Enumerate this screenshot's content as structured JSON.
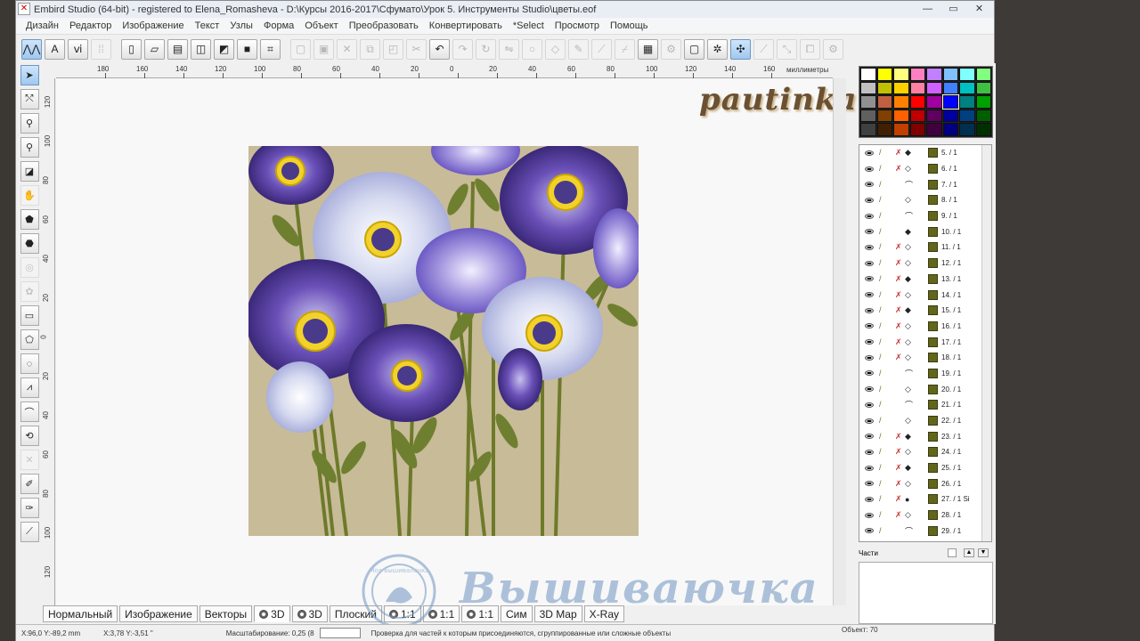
{
  "window": {
    "title": "Embird Studio (64-bit) - registered to Elena_Romasheva - D:\\Курсы 2016-2017\\Сфумато\\Урок 5. Инструменты Studio\\цветы.eof"
  },
  "menu": [
    "Дизайн",
    "Редактор",
    "Изображение",
    "Текст",
    "Узлы",
    "Форма",
    "Объект",
    "Преобразовать",
    "Конвертировать",
    "*Select",
    "Просмотр",
    "Помощь"
  ],
  "ruler": {
    "unit": "миллиметры",
    "top": [
      "180",
      "160",
      "140",
      "120",
      "100",
      "80",
      "60",
      "40",
      "20",
      "0",
      "20",
      "40",
      "60",
      "80",
      "100",
      "120",
      "140",
      "160"
    ],
    "left": [
      "120",
      "100",
      "80",
      "60",
      "40",
      "20",
      "0",
      "20",
      "40",
      "60",
      "80",
      "100",
      "120"
    ]
  },
  "logo": "pautinka",
  "view_tabs": [
    "Нормальный",
    "Изображение",
    "Векторы",
    "3D",
    "3D",
    "Плоский",
    "1:1",
    "1:1",
    "1:1",
    "Сим",
    "3D Map",
    "X-Ray"
  ],
  "watermark": {
    "text": "Вышиваючка",
    "seal": "Моя вышивалочка"
  },
  "status": {
    "coords1": "X:96,0 Y:-89,2 mm",
    "coords2": "X:3,78 Y:-3,51 \"",
    "zoom_label": "Масштабирование: 0,25 (8",
    "hint": "Проверка для частей к которым присоединяются, сгруппированные или сложные объекты",
    "objects": "Объект: 70"
  },
  "parts_label": "Части",
  "palette": [
    "#ffffff",
    "#ffff00",
    "#ffff80",
    "#ff80c0",
    "#c080ff",
    "#80c0ff",
    "#80ffff",
    "#80ff80",
    "#c0c0c0",
    "#c0c000",
    "#ffd000",
    "#ff80a0",
    "#d060ff",
    "#4080ff",
    "#00c0c0",
    "#40c040",
    "#909090",
    "#c06040",
    "#ff8000",
    "#ff0000",
    "#a000a0",
    "#0000ff",
    "#008080",
    "#00a000",
    "#606060",
    "#804000",
    "#ff6000",
    "#c00000",
    "#600060",
    "#0000a0",
    "#004080",
    "#006000",
    "#404040",
    "#402000",
    "#c04000",
    "#800000",
    "#400040",
    "#000080",
    "#003050",
    "#003000"
  ],
  "objects": [
    {
      "n": "5. / 1",
      "x": true,
      "k": "b"
    },
    {
      "n": "6. / 1",
      "x": true,
      "k": "e"
    },
    {
      "n": "7. / 1",
      "x": false,
      "k": "c"
    },
    {
      "n": "8. / 1",
      "x": false,
      "k": "e"
    },
    {
      "n": "9. / 1",
      "x": false,
      "k": "c"
    },
    {
      "n": "10. / 1",
      "x": false,
      "k": "b"
    },
    {
      "n": "11. / 1",
      "x": true,
      "k": "e"
    },
    {
      "n": "12. / 1",
      "x": true,
      "k": "e"
    },
    {
      "n": "13. / 1",
      "x": true,
      "k": "b"
    },
    {
      "n": "14. / 1",
      "x": true,
      "k": "e"
    },
    {
      "n": "15. / 1",
      "x": true,
      "k": "b"
    },
    {
      "n": "16. / 1",
      "x": true,
      "k": "e"
    },
    {
      "n": "17. / 1",
      "x": true,
      "k": "e"
    },
    {
      "n": "18. / 1",
      "x": true,
      "k": "e"
    },
    {
      "n": "19. / 1",
      "x": false,
      "k": "c"
    },
    {
      "n": "20. / 1",
      "x": false,
      "k": "e"
    },
    {
      "n": "21. / 1",
      "x": false,
      "k": "c"
    },
    {
      "n": "22. / 1",
      "x": false,
      "k": "e"
    },
    {
      "n": "23. / 1",
      "x": true,
      "k": "b"
    },
    {
      "n": "24. / 1",
      "x": true,
      "k": "e"
    },
    {
      "n": "25. / 1",
      "x": true,
      "k": "b"
    },
    {
      "n": "26. / 1",
      "x": true,
      "k": "e"
    },
    {
      "n": "27. / 1 Si",
      "x": true,
      "k": "r"
    },
    {
      "n": "28. / 1",
      "x": true,
      "k": "e"
    },
    {
      "n": "29. / 1",
      "x": false,
      "k": "c"
    }
  ]
}
